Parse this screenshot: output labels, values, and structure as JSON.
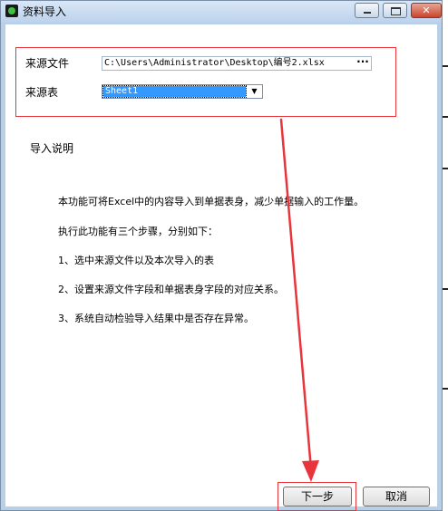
{
  "window": {
    "title": "资料导入",
    "close_glyph": "✕"
  },
  "form": {
    "file_label": "来源文件",
    "file_value": "C:\\Users\\Administrator\\Desktop\\编号2.xlsx",
    "browse_label": "···",
    "sheet_label": "来源表",
    "sheet_value": "Sheet1",
    "sheet_arrow": "▼"
  },
  "instructions": {
    "title": "导入说明",
    "lines": [
      "本功能可将Excel中的内容导入到单据表身，减少单据输入的工作量。",
      "执行此功能有三个步骤，分别如下：",
      "1、选中来源文件以及本次导入的表",
      "2、设置来源文件字段和单据表身字段的对应关系。",
      "3、系统自动检验导入结果中是否存在异常。"
    ]
  },
  "buttons": {
    "next": "下一步",
    "cancel": "取消"
  },
  "annotation": {
    "color": "#e8343a"
  },
  "icons": {
    "app": "app-icon",
    "minimize": "minimize-icon",
    "maximize": "maximize-icon",
    "close": "close-icon",
    "dropdown": "chevron-down-icon",
    "browse": "ellipsis-icon"
  }
}
